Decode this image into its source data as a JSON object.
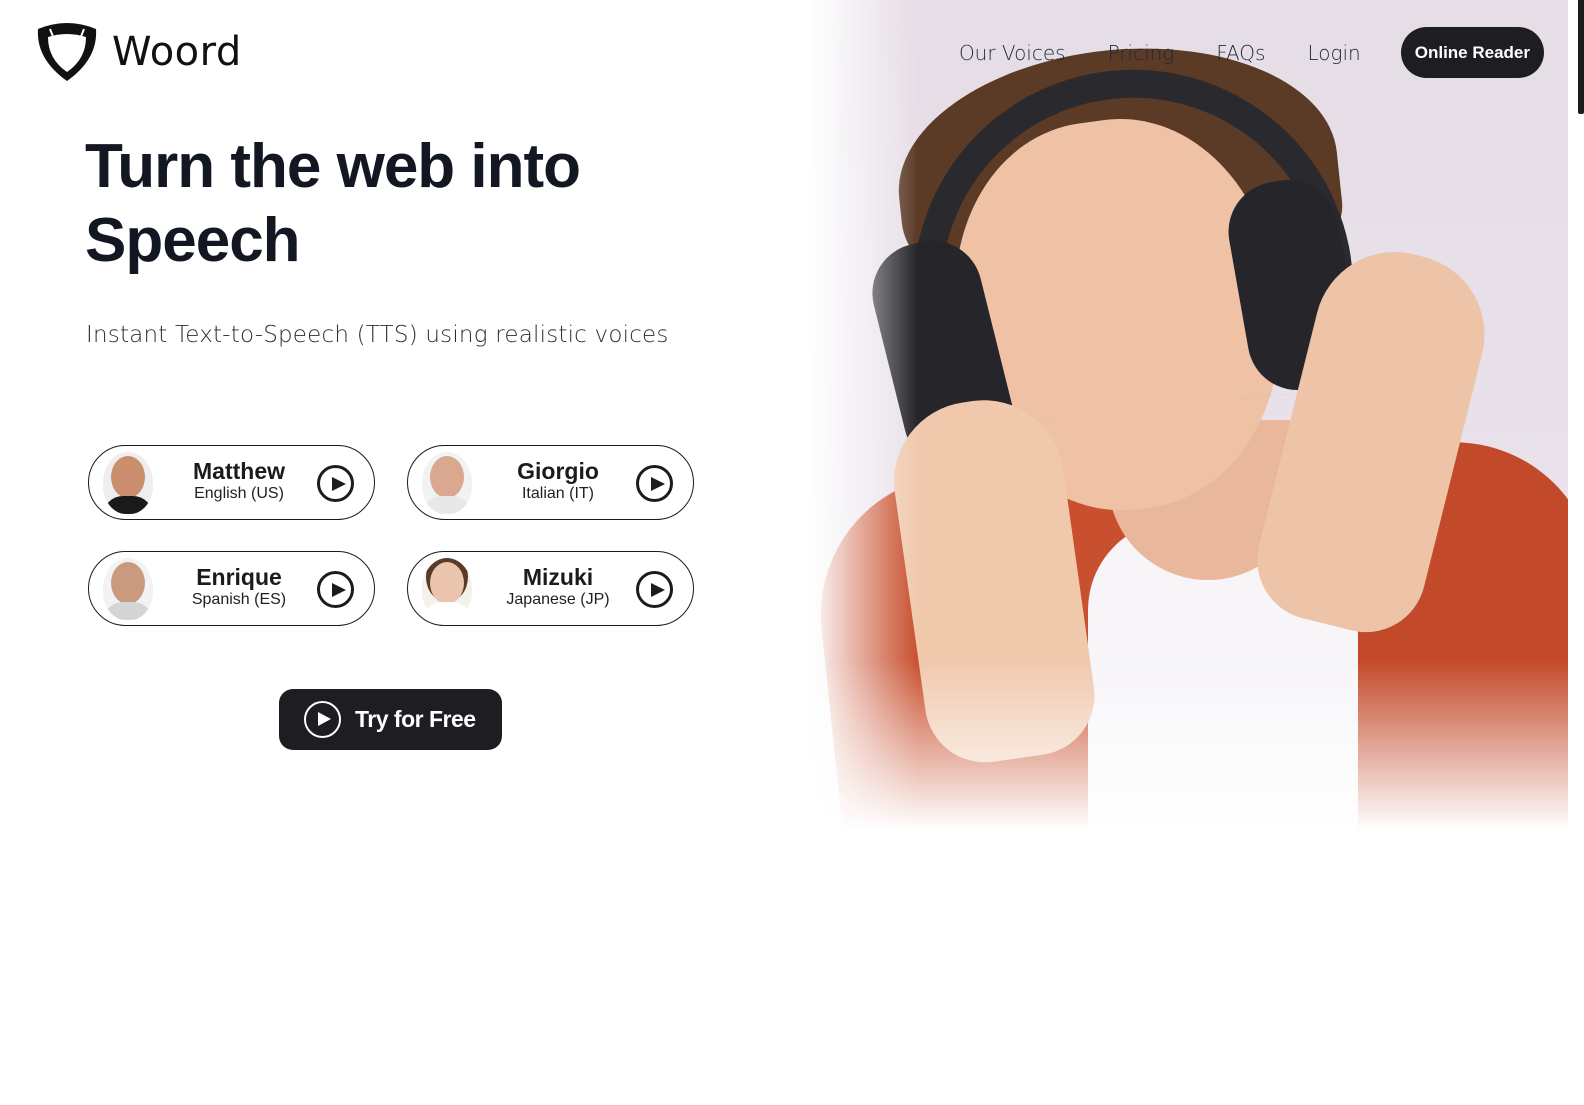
{
  "brand": {
    "name": "Woord",
    "logo_icon": "shield-icon"
  },
  "nav": {
    "links": [
      "Our Voices",
      "Pricing",
      "FAQs",
      "Login"
    ],
    "cta_label": "Online Reader"
  },
  "hero": {
    "headline_line1": "Turn the web into",
    "headline_line2": "Speech",
    "subheadline": "Instant Text-to-Speech (TTS) using realistic voices",
    "image_alt": "man-with-headphones-photo"
  },
  "voices": [
    {
      "name": "Matthew",
      "language": "English (US)",
      "icon": "play-icon"
    },
    {
      "name": "Giorgio",
      "language": "Italian (IT)",
      "icon": "play-icon"
    },
    {
      "name": "Enrique",
      "language": "Spanish (ES)",
      "icon": "play-icon"
    },
    {
      "name": "Mizuki",
      "language": "Japanese (JP)",
      "icon": "play-icon"
    }
  ],
  "cta": {
    "label": "Try for Free",
    "icon": "play-circle-icon"
  },
  "colors": {
    "primary_dark": "#1e1e22",
    "text": "#131722",
    "hero_bg": "#e8e0e8",
    "shirt": "#c8502f"
  }
}
